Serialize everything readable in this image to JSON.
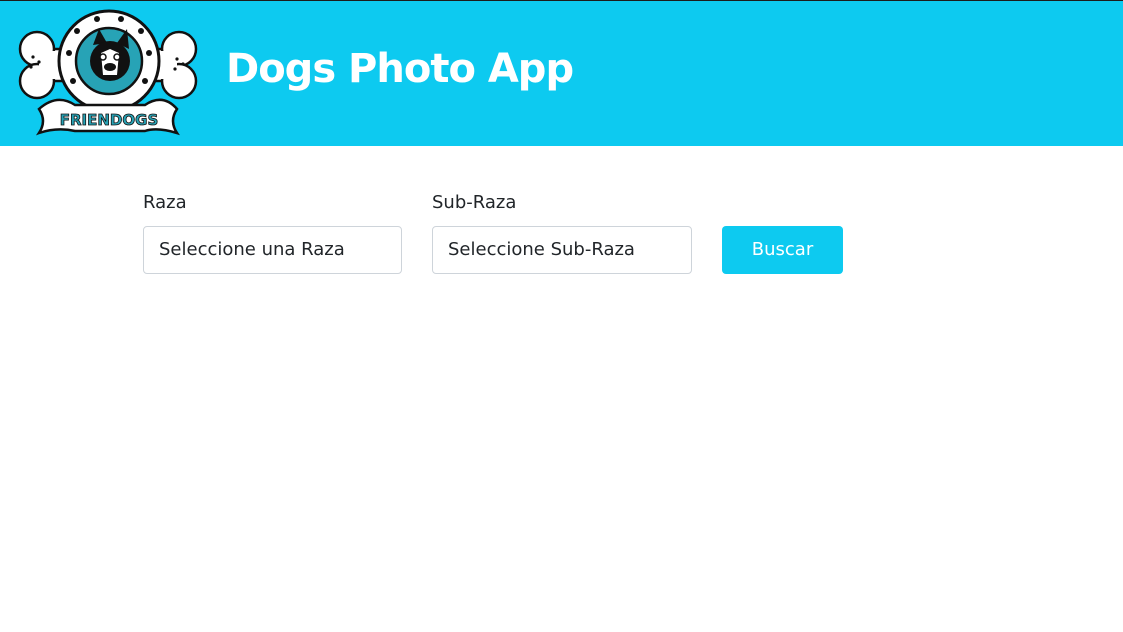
{
  "header": {
    "title": "Dogs Photo App",
    "logo": {
      "icon": "friendogs-logo",
      "text": "FRIENDOGS"
    },
    "background_color": "#0dcaf0"
  },
  "form": {
    "breed": {
      "label": "Raza",
      "value": "Seleccione una Raza"
    },
    "sub_breed": {
      "label": "Sub-Raza",
      "value": "Seleccione Sub-Raza"
    },
    "search_button": {
      "label": "Buscar",
      "color": "#0dcaf0"
    }
  }
}
